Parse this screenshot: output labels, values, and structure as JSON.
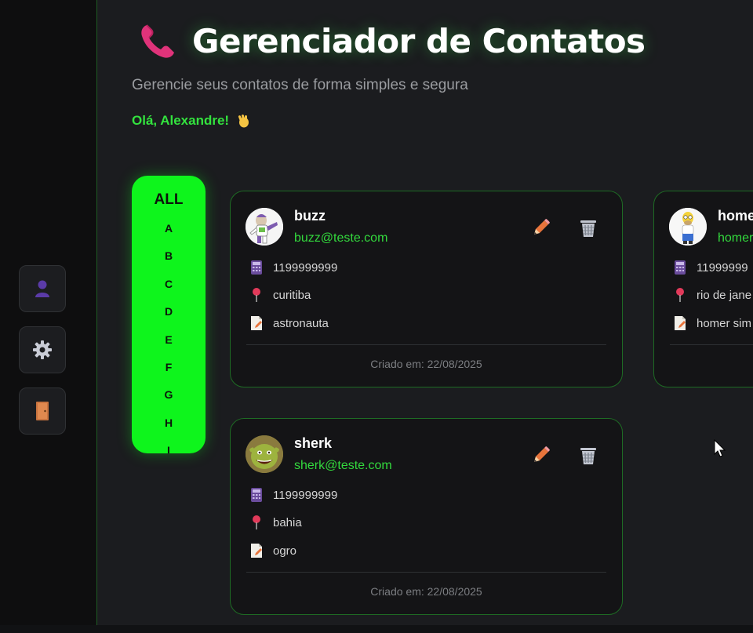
{
  "header": {
    "title": "Gerenciador de Contatos",
    "subtitle": "Gerencie seus contatos de forma simples e segura",
    "greeting": "Olá, Alexandre!",
    "greeting_icon": "waving-hand-icon",
    "title_icon": "telephone-receiver-icon"
  },
  "sidebar": {
    "items": [
      {
        "icon": "user-icon"
      },
      {
        "icon": "gear-icon"
      },
      {
        "icon": "door-icon"
      }
    ]
  },
  "alphabet": {
    "all_label": "ALL",
    "letters": [
      "A",
      "B",
      "C",
      "D",
      "E",
      "F",
      "G",
      "H",
      "I"
    ]
  },
  "contacts": [
    {
      "name": "buzz",
      "email": "buzz@teste.com",
      "phone": "1199999999",
      "city": "curitiba",
      "note": "astronauta",
      "created": "Criado em: 22/08/2025",
      "avatar": "buzz-lightyear-avatar"
    },
    {
      "name": "sherk",
      "email": "sherk@teste.com",
      "phone": "1199999999",
      "city": "bahia",
      "note": "ogro",
      "created": "Criado em: 22/08/2025",
      "avatar": "shrek-avatar"
    },
    {
      "name": "home",
      "email": "homer",
      "phone": "11999999",
      "city": "rio de jane",
      "note": "homer sim",
      "avatar": "homer-simpson-avatar"
    }
  ],
  "colors": {
    "accent": "#0ef51c",
    "email_green": "#33d93d",
    "card_border": "#1e6b24",
    "background": "#1b1c1f",
    "edit_orange": "#e8743b"
  }
}
